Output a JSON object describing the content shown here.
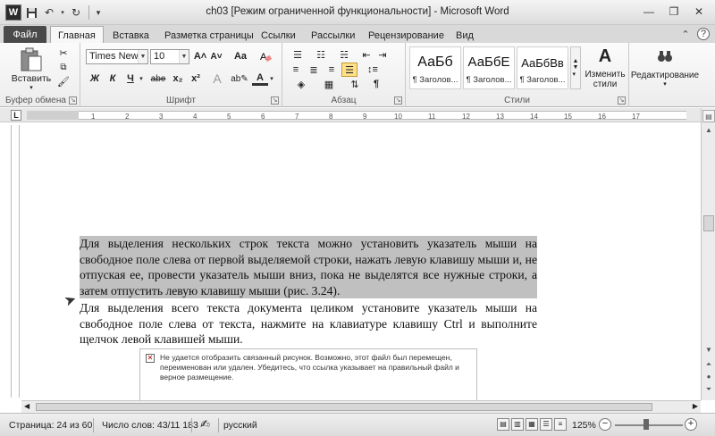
{
  "window": {
    "title": "ch03 [Режим ограниченной функциональности] - Microsoft Word"
  },
  "tabs": {
    "file": "Файл",
    "items": [
      "Главная",
      "Вставка",
      "Разметка страницы",
      "Ссылки",
      "Рассылки",
      "Рецензирование",
      "Вид"
    ]
  },
  "ribbon": {
    "clipboard": {
      "paste": "Вставить",
      "label": "Буфер обмена"
    },
    "font": {
      "family": "Times New Rc",
      "size": "10",
      "label": "Шрифт",
      "bold": "Ж",
      "italic": "К",
      "underline": "Ч",
      "strike": "abe",
      "sub": "x₂",
      "sup": "x²",
      "grow": "A˄",
      "shrink": "A˅",
      "case": "Aa",
      "color": "A"
    },
    "paragraph": {
      "label": "Абзац"
    },
    "styles": {
      "label": "Стили",
      "items": [
        {
          "sample": "АаБб",
          "name": "¶ Заголов..."
        },
        {
          "sample": "АаБбЕ",
          "name": "¶ Заголов..."
        },
        {
          "sample": "АаБбВв",
          "name": "¶ Заголов..."
        }
      ],
      "change": "Изменить стили"
    },
    "editing": {
      "label": "Редактирование"
    }
  },
  "ruler": {
    "numbers": [
      "1",
      "2",
      "3",
      "4",
      "5",
      "6",
      "7",
      "8",
      "9",
      "10",
      "11",
      "12",
      "13",
      "14",
      "15",
      "16",
      "17"
    ]
  },
  "document": {
    "para1": "Для выделения нескольких строк текста можно установить указатель мыши на свободное поле слева от первой выделяемой строки, нажать левую клавишу мыши и, не отпуская ее, провести указатель мыши вниз, пока не выделятся все нужные строки, а затем отпустить левую клавишу мыши (рис. 3.24).",
    "para2": "Для выделения всего текста документа целиком установите указатель мыши на свободное поле слева от текста, нажмите на клавиатуре клавишу Ctrl и выполните щелчок левой клавишей мыши.",
    "image_error": "Не удается отобразить связанный рисунок. Возможно, этот файл был перемещен, переименован или удален. Убедитесь, что ссылка указывает на правильный файл и верное размещение."
  },
  "status": {
    "page": "Страница: 24 из 60",
    "words": "Число слов: 43/11 183",
    "language": "русский",
    "zoom": "125%"
  }
}
